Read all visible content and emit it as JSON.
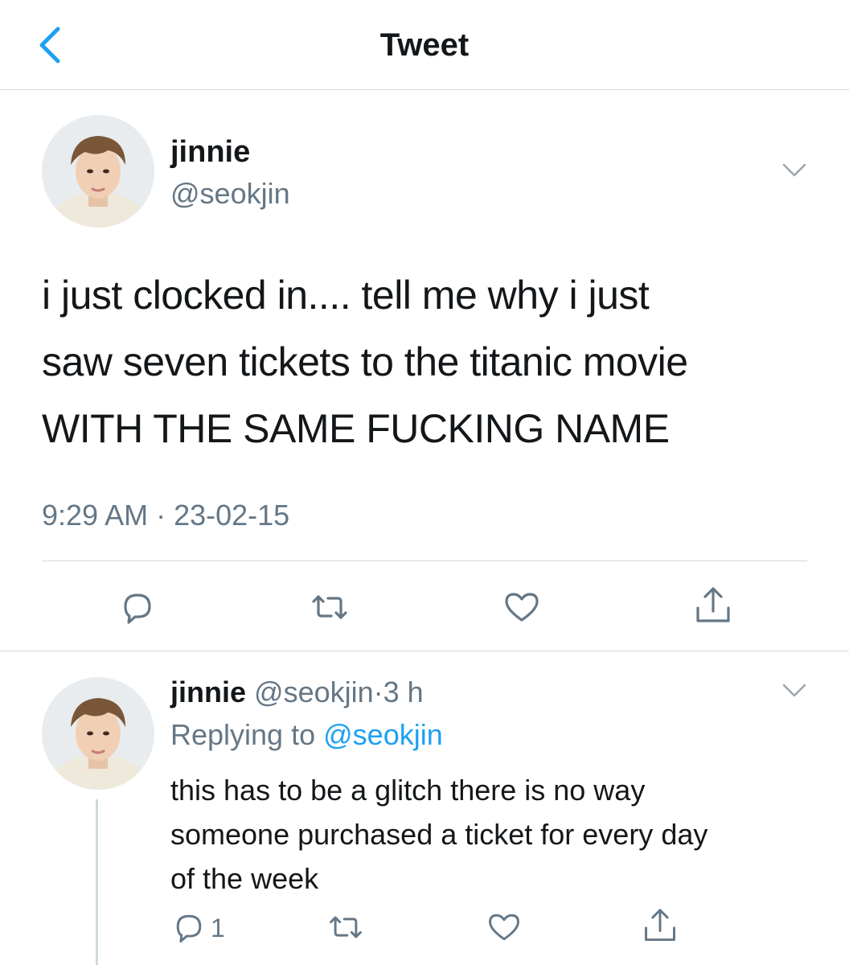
{
  "header": {
    "title": "Tweet",
    "back_icon": "chevron-left-icon",
    "accent": "#1da1f2"
  },
  "main_tweet": {
    "display_name": "jinnie",
    "handle": "@seokjin",
    "text_lines": [
      "i just clocked in.... tell me why i just",
      "saw seven tickets to the titanic movie",
      "WITH THE SAME FUCKING NAME"
    ],
    "timestamp": "9:29 AM · 23-02-15",
    "actions": [
      "reply-icon",
      "retweet-icon",
      "like-icon",
      "share-icon"
    ]
  },
  "reply_tweet": {
    "display_name": "jinnie",
    "handle": "@seokjin",
    "separator": "·",
    "time": "3 h",
    "replying_to_label": "Replying to",
    "replying_to_handle": "@seokjin",
    "text_lines": [
      "this has to be a glitch there is no way",
      "someone purchased a ticket for every day",
      "of the week"
    ],
    "reply_count": "1",
    "actions": [
      "reply-icon",
      "retweet-icon",
      "like-icon",
      "share-icon"
    ]
  }
}
